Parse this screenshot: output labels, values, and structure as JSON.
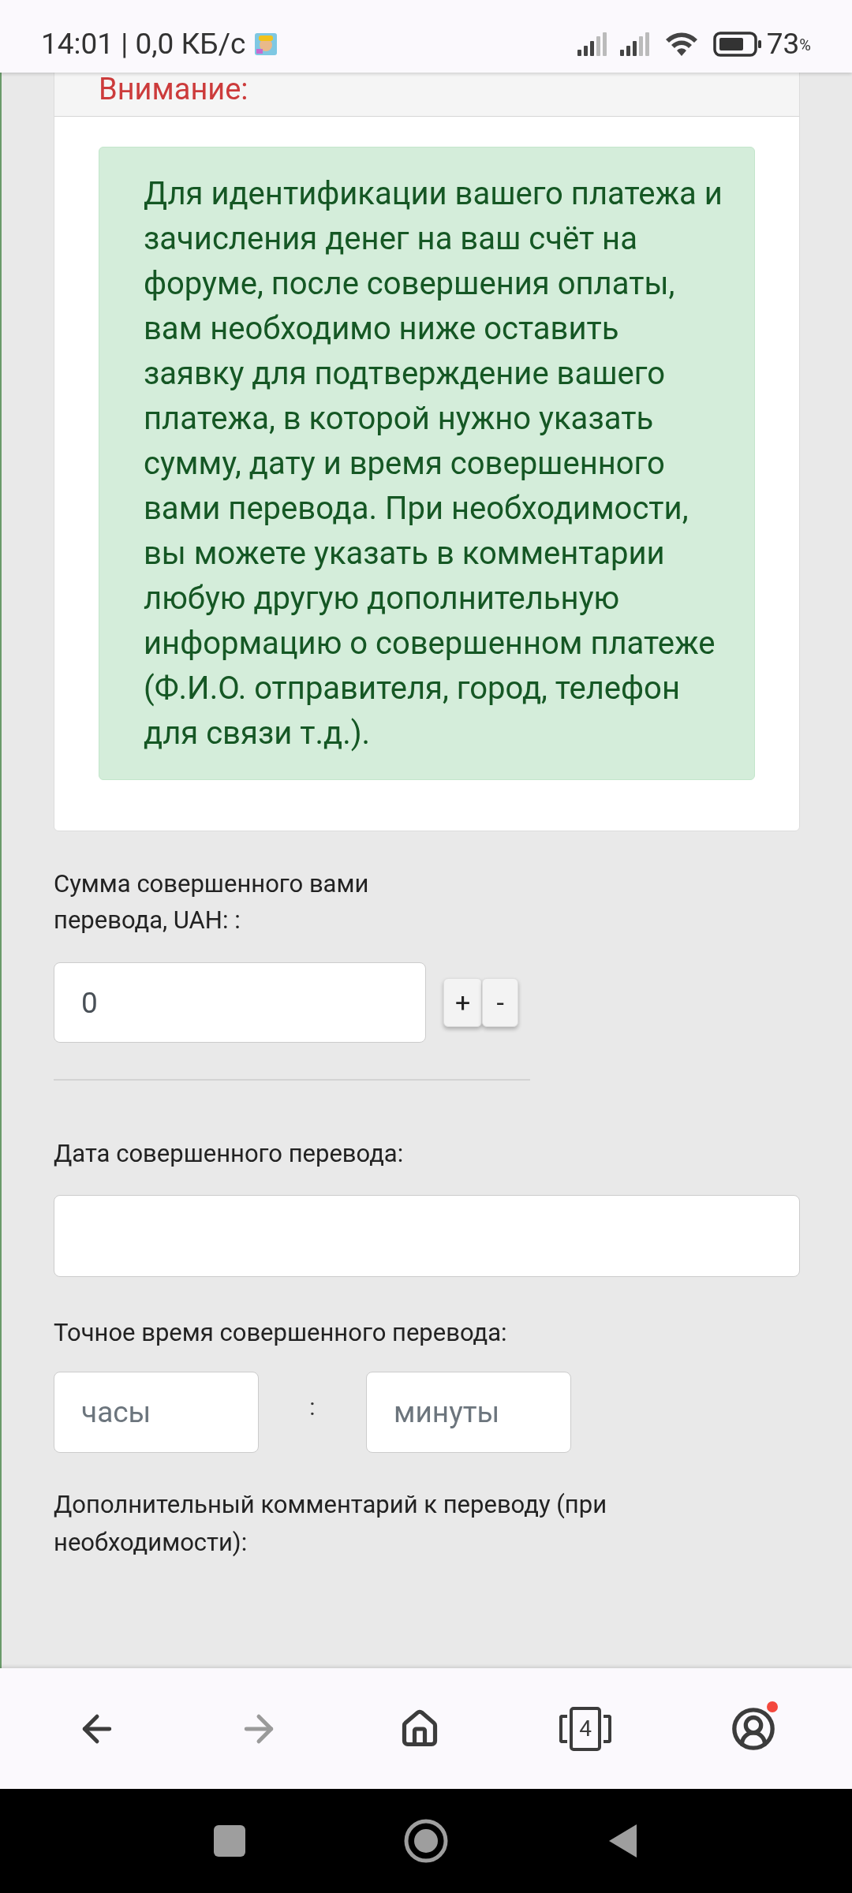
{
  "status_bar": {
    "time": "14:01 | 0,0 КБ/с",
    "battery": "73",
    "battery_unit": "%"
  },
  "notice": {
    "title": "Внимание:",
    "text": "Для идентификации вашего платежа и зачисления денег на ваш счёт на форуме, после совершения оплаты, вам необходимо ниже оставить заявку для подтверждение вашего платежа, в которой нужно указать сумму, дату и время совершенного вами перевода. При необходимости, вы можете указать в комментарии любую другую дополнительную информацию о совершенном платеже (Ф.И.О. отправителя, город, телефон для связи т.д.)."
  },
  "amount": {
    "label": "Сумма совершенного вами перевода, UAH: :",
    "value": "0",
    "buttons": [
      "+",
      "-"
    ]
  },
  "date": {
    "label": "Дата совершенного перевода:"
  },
  "time": {
    "label": "Точное время совершенного перевода:",
    "hours_placeholder": "часы",
    "separator": ":",
    "minutes_placeholder": "минуты"
  },
  "comment": {
    "label": "Дополнительный комментарий к переводу (при необходимости):"
  },
  "browser_nav": {
    "forward_disabled": true,
    "tab_count": "4",
    "profile_notification": true
  }
}
